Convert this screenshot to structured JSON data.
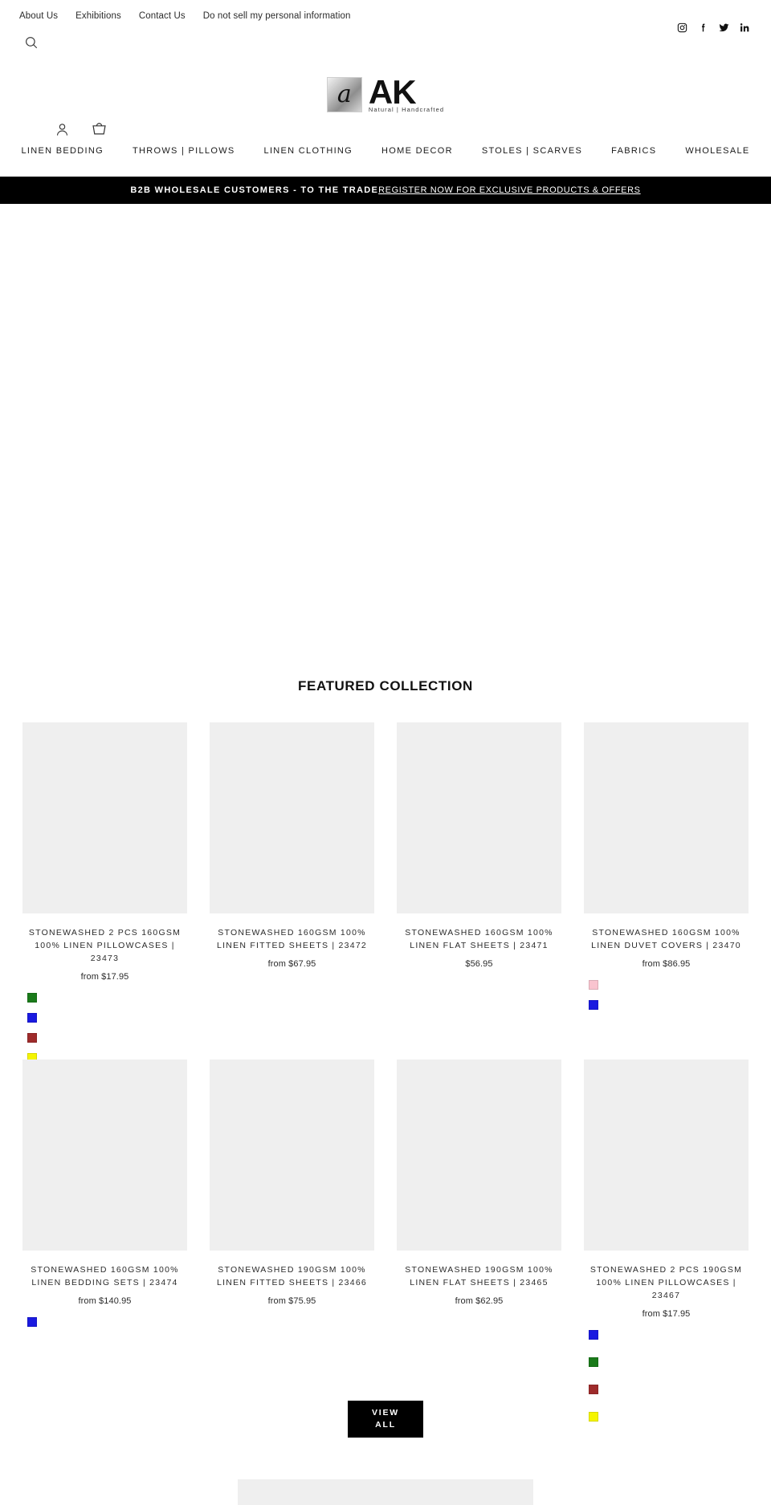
{
  "utility": {
    "links": [
      {
        "label": "About Us"
      },
      {
        "label": "Exhibitions"
      },
      {
        "label": "Contact Us"
      },
      {
        "label": "Do not sell my personal information"
      }
    ]
  },
  "social": [
    {
      "name": "instagram-icon",
      "label": "Instagram"
    },
    {
      "name": "facebook-icon",
      "label": "Facebook"
    },
    {
      "name": "twitter-icon",
      "label": "Twitter"
    },
    {
      "name": "linkedin-icon",
      "label": "LinkedIn"
    }
  ],
  "header": {
    "search_icon": "search-icon",
    "account_icon": "account-icon",
    "cart_icon": "cart-icon",
    "logo": {
      "mark_glyph": "a",
      "wordmark": "AK",
      "tagline": "Natural | Handcrafted"
    }
  },
  "main_nav": [
    {
      "label": "LINEN BEDDING"
    },
    {
      "label": "THROWS | PILLOWS"
    },
    {
      "label": "LINEN CLOTHING"
    },
    {
      "label": "HOME DECOR"
    },
    {
      "label": "STOLES | SCARVES"
    },
    {
      "label": "FABRICS"
    },
    {
      "label": "WHOLESALE"
    }
  ],
  "announcement": {
    "text": "B2B WHOLESALE CUSTOMERS - TO THE TRADE",
    "link": "REGISTER NOW FOR EXCLUSIVE PRODUCTS & OFFERS",
    "background": "#000000",
    "color": "#ffffff"
  },
  "featured": {
    "title": "FEATURED COLLECTION",
    "view_all": "VIEW\nALL",
    "view_all_line1": "VIEW",
    "view_all_line2": "ALL",
    "products": [
      {
        "title": "STONEWASHED 2 PCS 160GSM 100% LINEN PILLOWCASES | 23473",
        "price": "from $17.95",
        "swatches": [
          "#1a7a1a",
          "#1a1ae0",
          "#9e2b2b",
          "#f5f500"
        ]
      },
      {
        "title": "STONEWASHED 160GSM 100% LINEN FITTED SHEETS | 23472",
        "price": "from $67.95",
        "swatches": []
      },
      {
        "title": "STONEWASHED 160GSM 100% LINEN FLAT SHEETS | 23471",
        "price": "$56.95",
        "swatches": []
      },
      {
        "title": "STONEWASHED 160GSM 100% LINEN DUVET COVERS | 23470",
        "price": "from $86.95",
        "swatches": [
          "#f9c4cf",
          "#1a1ae0"
        ]
      },
      {
        "title": "STONEWASHED 160GSM 100% LINEN BEDDING SETS | 23474",
        "price": "from $140.95",
        "swatches": [
          "#1a1ae0"
        ]
      },
      {
        "title": "STONEWASHED 190GSM 100% LINEN FITTED SHEETS | 23466",
        "price": "from $75.95",
        "swatches": []
      },
      {
        "title": "STONEWASHED 190GSM 100% LINEN FLAT SHEETS | 23465",
        "price": "from $62.95",
        "swatches": []
      },
      {
        "title": "STONEWASHED 2 PCS 190GSM 100% LINEN PILLOWCASES | 23467",
        "price": "from $17.95",
        "swatches": [
          "#1a1ae0",
          "#1a7a1a",
          "#9e2b2b",
          "#f5f500"
        ]
      }
    ]
  }
}
